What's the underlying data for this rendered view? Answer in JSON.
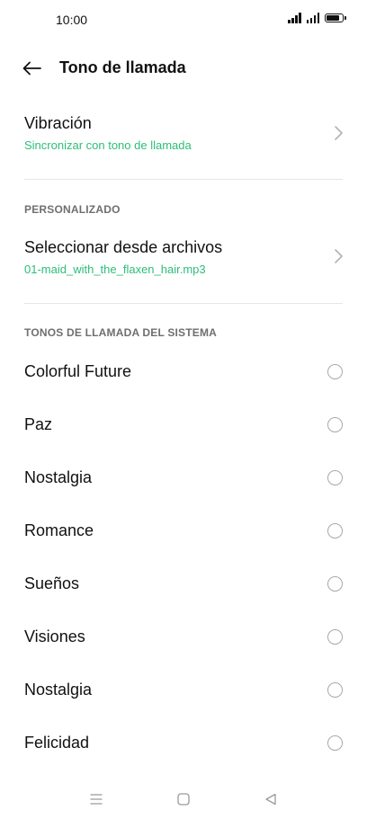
{
  "status_bar": {
    "time": "10:00"
  },
  "header": {
    "title": "Tono de llamada"
  },
  "vibration": {
    "label": "Vibración",
    "value": "Sincronizar con tono de llamada"
  },
  "custom_section": {
    "heading": "PERSONALIZADO",
    "label": "Seleccionar desde archivos",
    "value": "01-maid_with_the_flaxen_hair.mp3"
  },
  "system_section": {
    "heading": "TONOS DE LLAMADA DEL SISTEMA",
    "tones": [
      {
        "label": "Colorful Future",
        "selected": false
      },
      {
        "label": "Paz",
        "selected": false
      },
      {
        "label": "Nostalgia",
        "selected": false
      },
      {
        "label": "Romance",
        "selected": false
      },
      {
        "label": "Sueños",
        "selected": false
      },
      {
        "label": "Visiones",
        "selected": false
      },
      {
        "label": "Nostalgia",
        "selected": false
      },
      {
        "label": "Felicidad",
        "selected": false
      }
    ]
  },
  "colors": {
    "accent": "#2dbe7a",
    "text": "#111111",
    "section": "#6f6f6f"
  },
  "nav_bar": {
    "icons": [
      "menu-icon",
      "home-icon",
      "back-triangle-icon"
    ]
  }
}
